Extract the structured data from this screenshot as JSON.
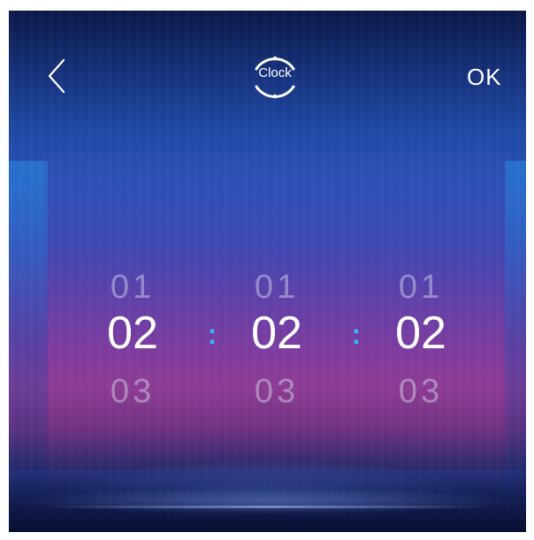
{
  "header": {
    "title": "Clock",
    "ok_label": "OK"
  },
  "picker": {
    "separator": ":",
    "hours": {
      "prev": "01",
      "current": "02",
      "next": "03"
    },
    "minutes": {
      "prev": "01",
      "current": "02",
      "next": "03"
    },
    "seconds": {
      "prev": "01",
      "current": "02",
      "next": "03"
    }
  },
  "icons": {
    "back": "chevron-left-icon",
    "clock": "clock-dial-icon"
  },
  "colors": {
    "accent": "#35b8ff",
    "text": "#ffffff",
    "muted_text": "#c8c8e6"
  }
}
